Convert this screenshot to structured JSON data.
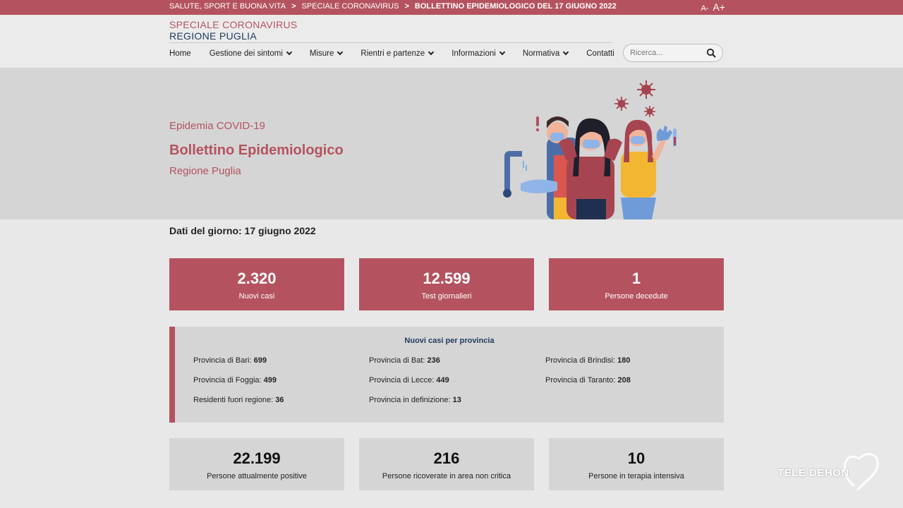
{
  "topbar": {
    "breadcrumbs": [
      "SALUTE, SPORT E BUONA VITA",
      "SPECIALE CORONAVIRUS",
      "BOLLETTINO EPIDEMIOLOGICO DEL 17 GIUGNO 2022"
    ],
    "separator": ">",
    "font_smaller": "A-",
    "font_larger": "A+"
  },
  "brand": {
    "line1": "SPECIALE CORONAVIRUS",
    "line2": "REGIONE PUGLIA"
  },
  "nav": {
    "items": [
      "Home",
      "Gestione dei sintomi",
      "Misure",
      "Rientri e partenze",
      "Informazioni",
      "Normativa",
      "Contatti"
    ]
  },
  "search": {
    "placeholder": "Ricerca..."
  },
  "hero": {
    "eyebrow": "Epidemia COVID-19",
    "title": "Bollettino Epidemiologico",
    "subtitle": "Regione Puglia"
  },
  "date_line": "Dati del giorno: 17 giugno 2022",
  "top_cards": [
    {
      "value": "2.320",
      "label": "Nuovi casi"
    },
    {
      "value": "12.599",
      "label": "Test giornalieri"
    },
    {
      "value": "1",
      "label": "Persone decedute"
    }
  ],
  "province": {
    "title": "Nuovi casi per provincia",
    "items": [
      {
        "label": "Provincia di Bari:",
        "value": "699"
      },
      {
        "label": "Provincia di Bat:",
        "value": "236"
      },
      {
        "label": "Provincia di Brindisi:",
        "value": "180"
      },
      {
        "label": "Provincia di Foggia:",
        "value": "499"
      },
      {
        "label": "Provincia di Lecce:",
        "value": "449"
      },
      {
        "label": "Provincia di Taranto:",
        "value": "208"
      },
      {
        "label": "Residenti fuori regione:",
        "value": "36"
      },
      {
        "label": "Provincia in definizione:",
        "value": "13"
      }
    ]
  },
  "bottom_cards": [
    {
      "value": "22.199",
      "label": "Persone attualmente positive"
    },
    {
      "value": "216",
      "label": "Persone ricoverate in area non critica"
    },
    {
      "value": "10",
      "label": "Persone in terapia intensiva"
    }
  ],
  "watermark": {
    "text": "TELE DEHON"
  },
  "colors": {
    "accent": "#b4535f",
    "navy": "#1f3a5f",
    "panel": "#d5d5d5"
  }
}
